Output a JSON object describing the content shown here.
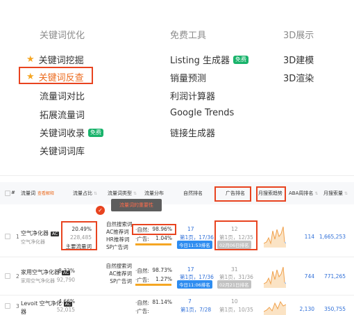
{
  "menu": {
    "columns": [
      {
        "heading": "关键词优化",
        "items": [
          "关键词挖掘",
          "关键词反查",
          "流量词对比",
          "拓展流量词",
          "关键词收录",
          "关键词词库"
        ]
      },
      {
        "heading": "免费工具",
        "items": [
          "Listing 生成器",
          "销量预测",
          "利润计算器",
          "Google Trends",
          "链接生成器"
        ]
      },
      {
        "heading": "3D展示",
        "items": [
          "3D建模",
          "3D渲染"
        ]
      }
    ],
    "free_badge": "免费",
    "active_item": "关键词反查",
    "colors": {
      "accent": "#ec6b1f",
      "star": "#f5a623",
      "highlight_border": "#e8431f",
      "free_badge": "#19b36b"
    }
  },
  "table": {
    "headers": {
      "hash": "#",
      "keyword": "流量词",
      "keyword_help": "查看解释",
      "share": "流量占比",
      "type": "流量词类型",
      "dist": "流量分布",
      "organic": "自然排名",
      "ad": "广告排名",
      "trend": "月搜索趋势",
      "aba": "ABA周排名",
      "volume": "月搜索量"
    },
    "tooltip": "流量词的重要性",
    "type_labels": [
      "自然搜索词",
      "AC推荐词",
      "HR推荐词",
      "SP广告词"
    ],
    "dist_labels": {
      "organic": "·自然:",
      "ad": "·广告:"
    },
    "main_flag": "主要流量词",
    "rows": [
      {
        "rank": "1",
        "keyword": "空气净化器",
        "badge": "AC",
        "keyword_sub": "空气净化器",
        "share": "20.49%",
        "count": "228,485",
        "organic_pct": "98.96%",
        "ad_pct": "1.04%",
        "organic_rank": "17",
        "organic_page": "第1页，17/36",
        "organic_time": "今日11:53排名",
        "ad_rank": "12",
        "ad_page": "第1页，12/35",
        "ad_time": "02月06日排名",
        "aba": "114",
        "volume": "1,665,253"
      },
      {
        "rank": "2",
        "keyword": "家用空气净化器",
        "badge": "AC",
        "keyword_sub": "家用空气净化器",
        "share": "8.32%",
        "count": "92,790",
        "organic_pct": "98.73%",
        "ad_pct": "1.27%",
        "organic_rank": "17",
        "organic_page": "第1页，17/36",
        "organic_time": "今日11:06排名",
        "ad_rank": "31",
        "ad_page": "第1页，31/36",
        "ad_time": "02月21日排名",
        "aba": "744",
        "volume": "771,265"
      },
      {
        "rank": "3",
        "keyword": "Levoit 空气净化",
        "keyword_tail": "器",
        "badge": "AC",
        "share": "4.66%",
        "count": "52,015",
        "organic_pct": "81.14%",
        "organic_rank": "7",
        "organic_page": "第1页，7/28",
        "ad_rank": "10",
        "ad_page": "第1页，10/35",
        "aba": "2,130",
        "volume": "350,755"
      }
    ],
    "chart_colors": {
      "line": "#f0a04b",
      "fill": "#fbe3c4",
      "tail": "#8fb5e8"
    },
    "rank_btn_colors": {
      "organic": "#2f8df0",
      "ad": "#c2c2c2"
    }
  }
}
